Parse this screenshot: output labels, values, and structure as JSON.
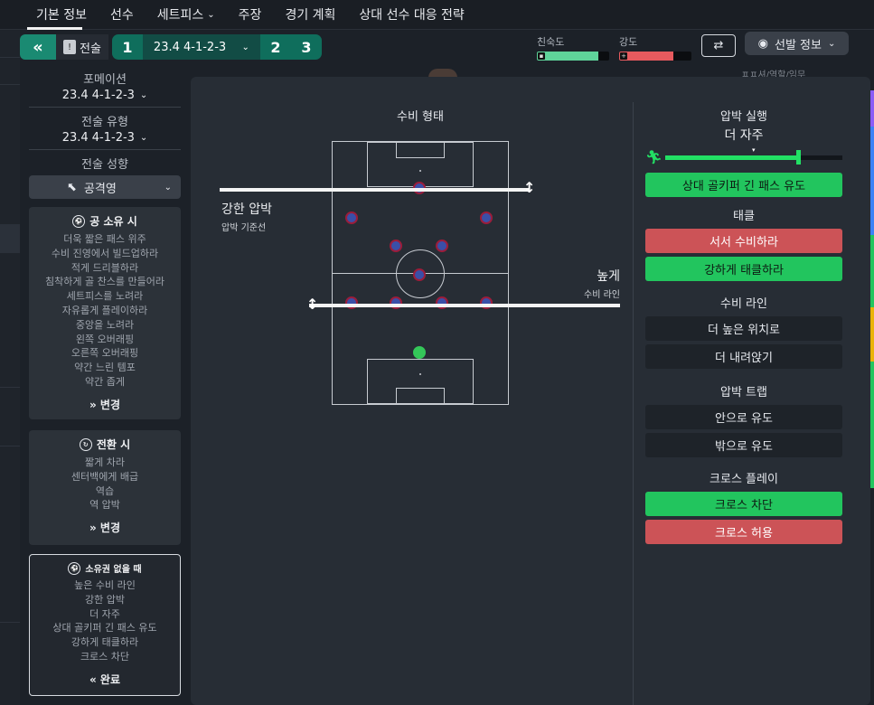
{
  "nav": {
    "tabs": [
      {
        "label": "기본 정보",
        "dropdown": false
      },
      {
        "label": "선수",
        "dropdown": false
      },
      {
        "label": "세트피스",
        "dropdown": true
      },
      {
        "label": "주장",
        "dropdown": false
      },
      {
        "label": "경기 계획",
        "dropdown": false
      },
      {
        "label": "상대 선수 대응 전략",
        "dropdown": false
      }
    ]
  },
  "toolbar": {
    "tactic_label": "전술",
    "slot1": "1",
    "formation": "23.4 4-1-2-3",
    "slot2": "2",
    "slot3": "3",
    "familiarity_label": "친숙도",
    "familiarity_value": 0.85,
    "intensity_label": "강도",
    "intensity_value": 0.75,
    "lineup_label": "선발 정보"
  },
  "left_panel": {
    "formation_label": "포메이션",
    "formation_value": "23.4 4-1-2-3",
    "tactic_type_label": "전술 유형",
    "tactic_type_value": "23.4 4-1-2-3",
    "style_label": "전술 성향",
    "style_value": "공격영",
    "in_possession": {
      "title": "공 소유 시",
      "items": [
        "더욱 짧은 패스 위주",
        "수비 진영에서 빌드업하라",
        "적게 드리블하라",
        "침착하게 골 찬스를 만들어라",
        "세트피스를 노려라",
        "자유롭게 플레이하라",
        "중앙을 노려라",
        "왼쪽 오버래핑",
        "오른쪽 오버래핑",
        "약간 느린 템포",
        "약간 좁게"
      ],
      "action": "변경"
    },
    "transition": {
      "title": "전환 시",
      "items": [
        "짧게 차라",
        "센터백에게 배급",
        "역습",
        "역 압박"
      ],
      "action": "변경"
    },
    "out_of_possession": {
      "title": "소유권 없을 때",
      "items": [
        "높은 수비 라인",
        "강한 압박",
        "더 자주",
        "상대 골키퍼 긴 패스 유도",
        "강하게 태클하라",
        "크로스 차단"
      ],
      "action": "완료"
    }
  },
  "pitch_panel": {
    "title": "수비 형태",
    "press_label": "강한 압박",
    "press_sub": "압박 기준선",
    "line_label": "높게",
    "line_sub": "수비 라인"
  },
  "right_panel": {
    "pressing": {
      "title": "압박 실행",
      "value": "더 자주",
      "level": 0.75,
      "option": "상대 골키퍼 긴 패스 유도"
    },
    "tackle": {
      "title": "태클",
      "options": [
        "서서 수비하라",
        "강하게 태클하라"
      ]
    },
    "defline": {
      "title": "수비 라인",
      "options": [
        "더 높은 위치로",
        "더 내려앉기"
      ]
    },
    "trap": {
      "title": "압박 트랩",
      "options": [
        "안으로 유도",
        "밖으로 유도"
      ]
    },
    "cross": {
      "title": "크로스 플레이",
      "options": [
        "크로스 차단",
        "크로스 허용"
      ]
    }
  },
  "misc": {
    "top_right_text": "ㅍㅍ셔/역할/임무"
  }
}
